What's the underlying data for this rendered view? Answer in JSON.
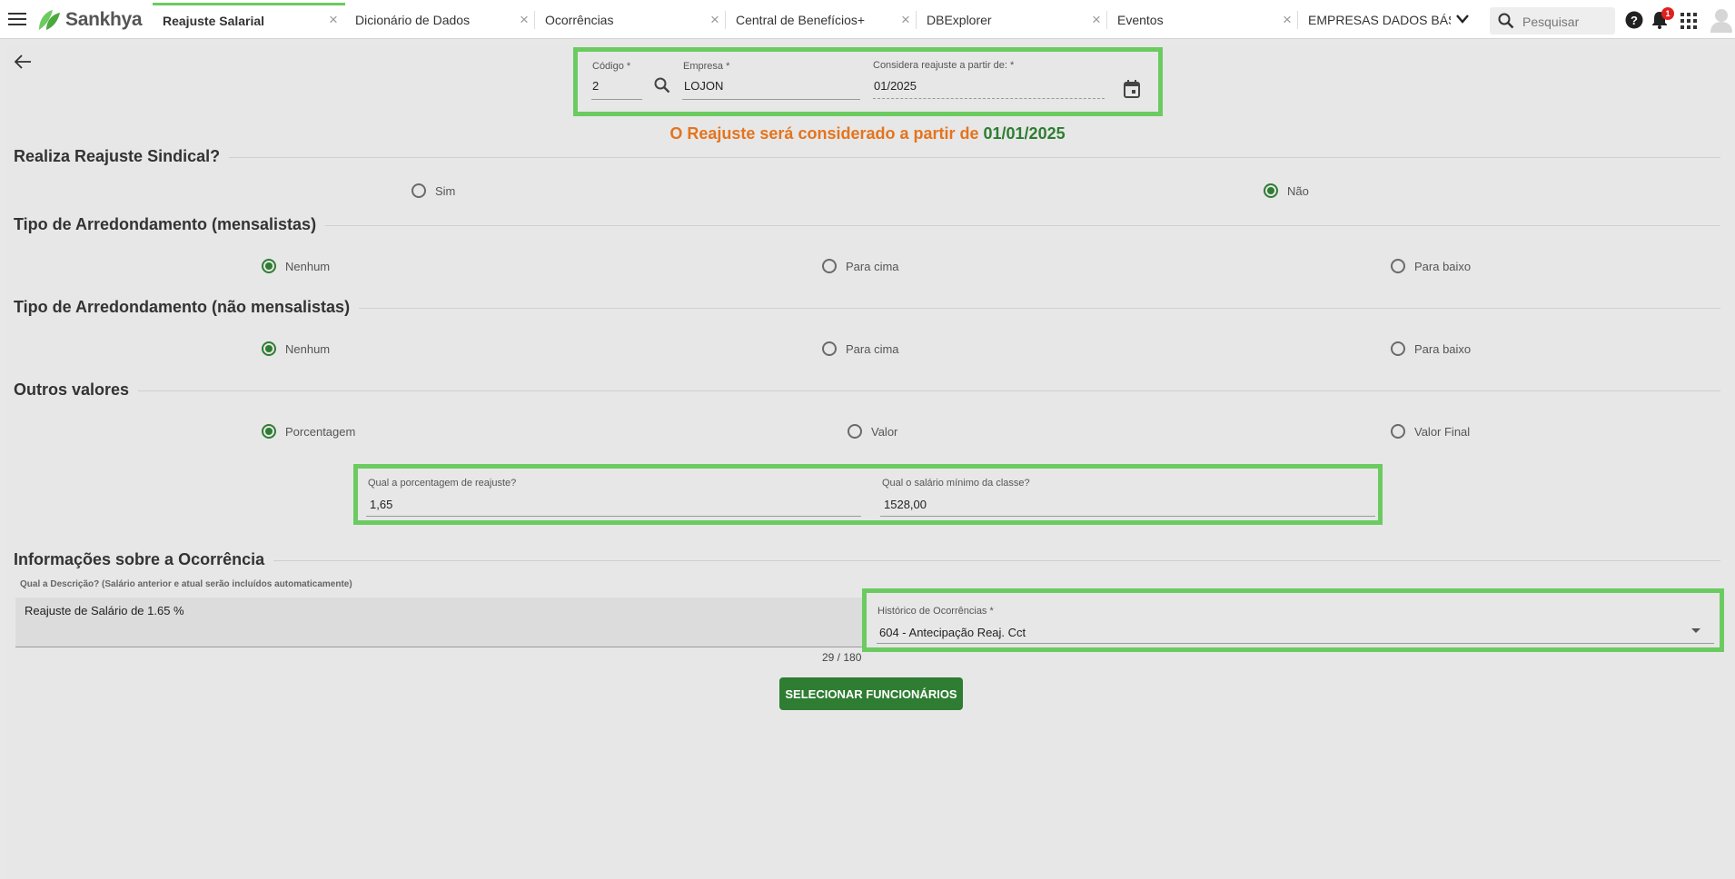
{
  "app": {
    "logo_text": "Sankhya",
    "accent_color": "#6bcb60",
    "primary_color": "#2e7d32",
    "warning_color": "#e4741d"
  },
  "tabs": [
    {
      "label": "Reajuste Salarial",
      "active": true
    },
    {
      "label": "Dicionário de Dados"
    },
    {
      "label": "Ocorrências"
    },
    {
      "label": "Central de Benefícios+"
    },
    {
      "label": "DBExplorer"
    },
    {
      "label": "Eventos"
    },
    {
      "label": "EMPRESAS DADOS BÁSI"
    }
  ],
  "header": {
    "search_placeholder": "Pesquisar",
    "notification_count": "1"
  },
  "top_fields": {
    "codigo": {
      "label": "Código *",
      "value": "2"
    },
    "empresa": {
      "label": "Empresa *",
      "value": "LOJON"
    },
    "data": {
      "label": "Considera reajuste a partir de: *",
      "value": "01/2025"
    }
  },
  "notice": {
    "text": "O Reajuste será considerado a partir de ",
    "date": "01/01/2025"
  },
  "sections": {
    "sindical": {
      "title": "Realiza Reajuste Sindical?",
      "options": [
        "Sim",
        "Não"
      ],
      "selected": "Não"
    },
    "arred_mensal": {
      "title": "Tipo de Arredondamento (mensalistas)",
      "options": [
        "Nenhum",
        "Para cima",
        "Para baixo"
      ],
      "selected": "Nenhum"
    },
    "arred_nao_mensal": {
      "title": "Tipo de Arredondamento (não mensalistas)",
      "options": [
        "Nenhum",
        "Para cima",
        "Para baixo"
      ],
      "selected": "Nenhum"
    },
    "outros": {
      "title": "Outros valores",
      "options": [
        "Porcentagem",
        "Valor",
        "Valor Final"
      ],
      "selected": "Porcentagem"
    },
    "ocorrencia": {
      "title": "Informações sobre a Ocorrência"
    }
  },
  "values": {
    "porcentagem": {
      "label": "Qual a porcentagem de reajuste?",
      "value": "1,65"
    },
    "salario_minimo": {
      "label": "Qual o salário mínimo da classe?",
      "value": "1528,00"
    }
  },
  "descricao": {
    "label": "Qual a Descrição? (Salário anterior e atual serão incluídos automaticamente)",
    "value": "Reajuste de Salário de 1.65 %",
    "counter": "29 / 180"
  },
  "historico": {
    "label": "Histórico de Ocorrências *",
    "value": "604 - Antecipação Reaj. Cct"
  },
  "actions": {
    "select_label": "SELECIONAR FUNCIONÁRIOS"
  }
}
